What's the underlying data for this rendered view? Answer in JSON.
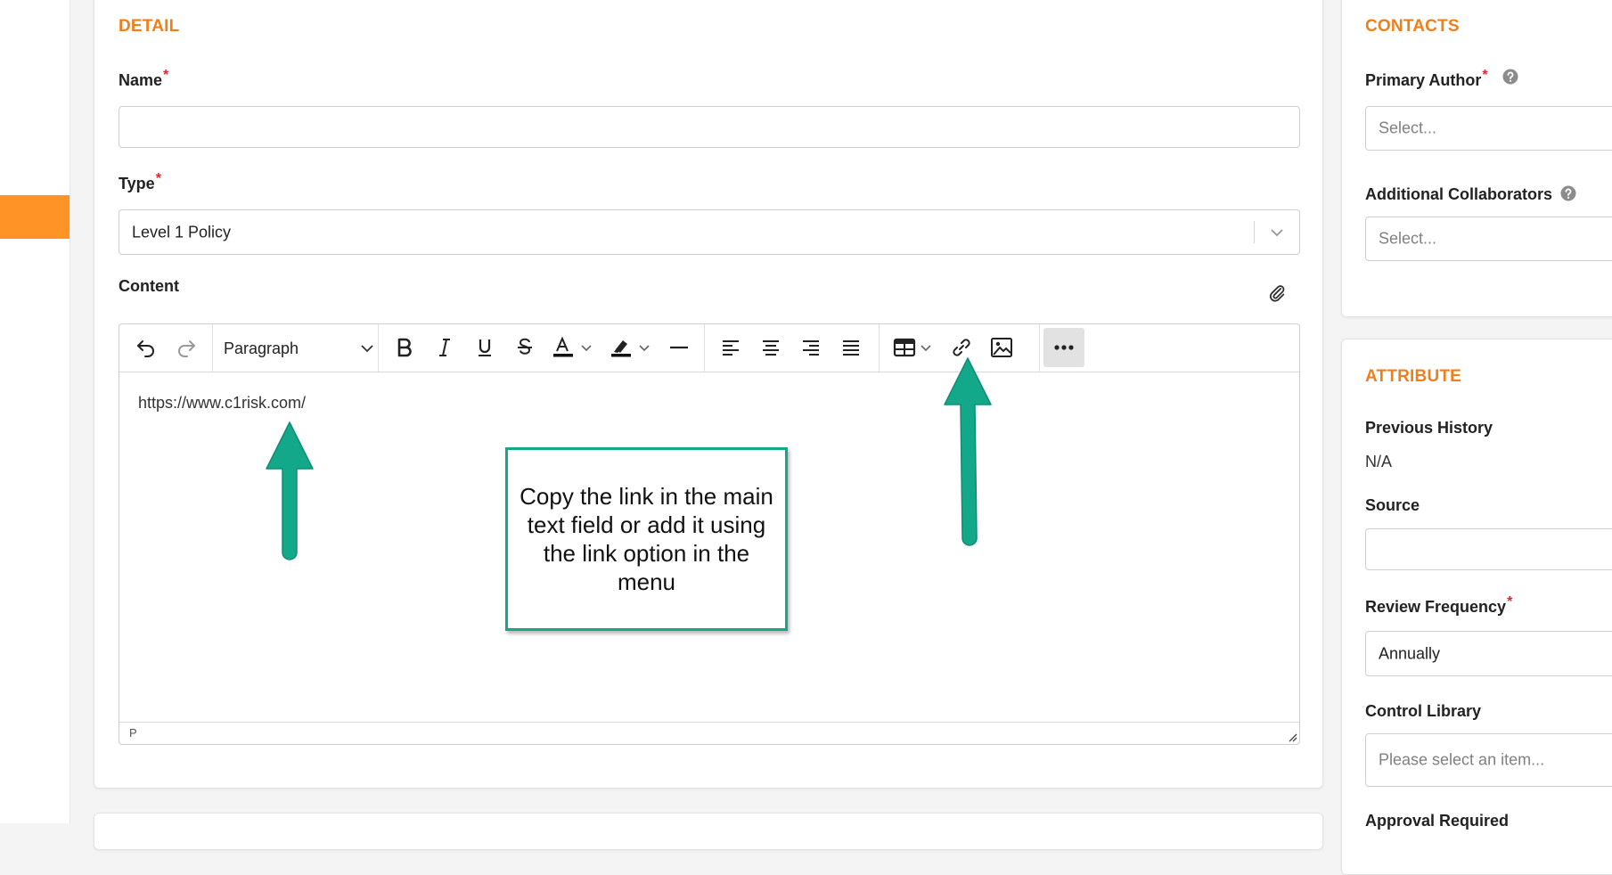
{
  "detail": {
    "heading": "DETAIL",
    "name_label": "Name",
    "required_mark": "*",
    "type_label": "Type",
    "type_value": "Level 1 Policy",
    "content_label": "Content"
  },
  "editor": {
    "undo_icon": "undo-icon",
    "redo_icon": "redo-icon",
    "block_format": "Paragraph",
    "content_text": "https://www.c1risk.com/",
    "status_path": "P"
  },
  "annotation": {
    "callout_text": "Copy the link in the main text field or add it using the link option in the menu",
    "arrow_color": "#12a889"
  },
  "contacts": {
    "heading": "CONTACTS",
    "primary_author_label": "Primary Author",
    "primary_author_placeholder": "Select...",
    "collaborators_label": "Additional Collaborators",
    "collaborators_placeholder": "Select..."
  },
  "attribute": {
    "heading": "ATTRIBUTE",
    "previous_history_label": "Previous History",
    "previous_history_value": "N/A",
    "source_label": "Source",
    "review_frequency_label": "Review Frequency",
    "review_frequency_value": "Annually",
    "control_library_label": "Control Library",
    "control_library_placeholder": "Please select an item...",
    "approval_required_label": "Approval Required"
  },
  "colors": {
    "accent_orange": "#ef7f1a",
    "sidebar_active": "#ff9326",
    "required_red": "#e0262d",
    "annotation_green": "#12a889"
  }
}
